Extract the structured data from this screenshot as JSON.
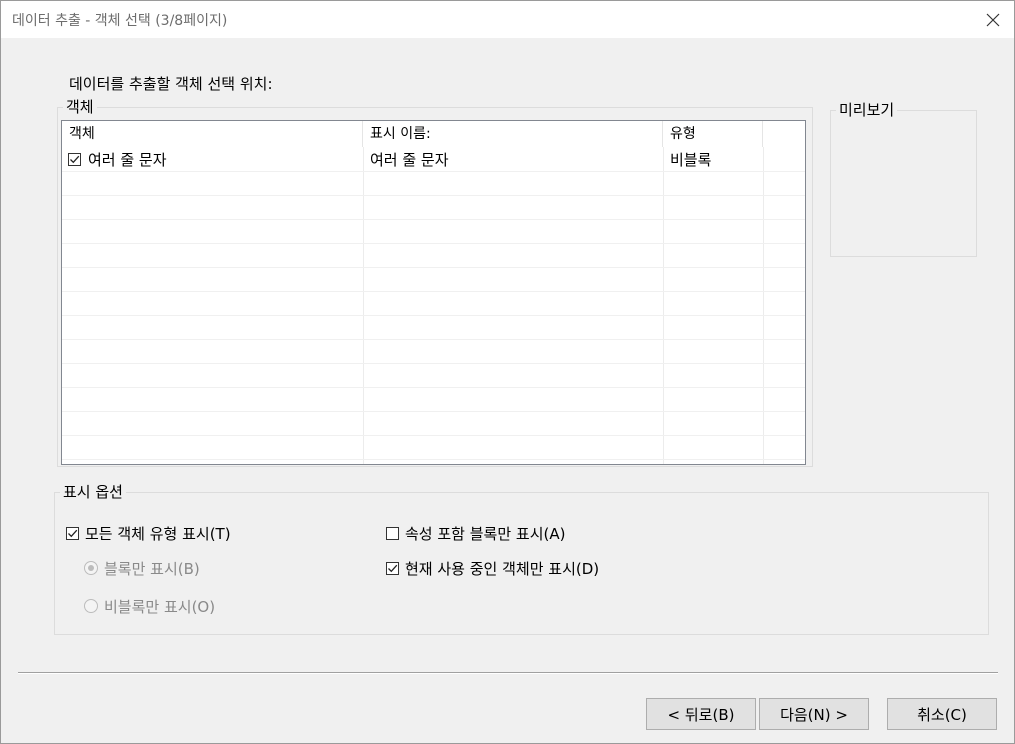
{
  "window": {
    "title": "데이터 추출 - 객체 선택 (3/8페이지)",
    "close_icon": "close-icon"
  },
  "prompt": "데이터를 추출할 객체 선택 위치:",
  "objects_group": {
    "legend": "객체",
    "columns": [
      "객체",
      "표시 이름:",
      "유형"
    ],
    "rows": [
      {
        "checked": true,
        "object": "여러 줄 문자",
        "display_name": "여러 줄 문자",
        "type": "비블록"
      }
    ]
  },
  "preview_group": {
    "legend": "미리보기"
  },
  "display_options": {
    "legend": "표시 옵션",
    "show_all_types": {
      "label": "모든 객체 유형 표시(T)",
      "checked": true
    },
    "blocks_only": {
      "label": "블록만 표시(B)",
      "selected": true,
      "disabled": true
    },
    "nonblocks_only": {
      "label": "비블록만 표시(O)",
      "selected": false,
      "disabled": true
    },
    "blocks_with_attrs": {
      "label": "속성 포함 블록만 표시(A)",
      "checked": false
    },
    "in_use_only": {
      "label": "현재 사용 중인 객체만 표시(D)",
      "checked": true
    }
  },
  "buttons": {
    "back": "< 뒤로(B)",
    "next": "다음(N) >",
    "cancel": "취소(C)"
  },
  "colors": {
    "dialog_bg": "#f0f0f0",
    "button_bg": "#e1e1e1",
    "disabled_text": "#8a8a8a"
  }
}
